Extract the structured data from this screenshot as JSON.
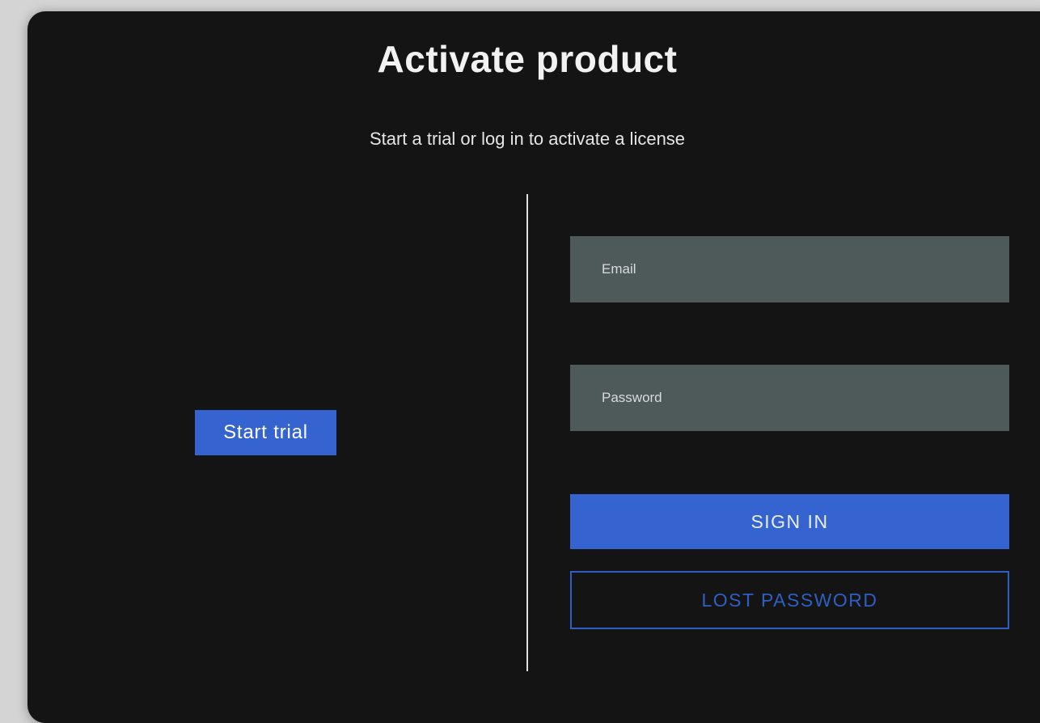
{
  "dialog": {
    "title": "Activate product",
    "subtitle": "Start a trial or log in to activate a license"
  },
  "trial": {
    "start_label": "Start trial"
  },
  "login": {
    "email_placeholder": "Email",
    "email_value": "",
    "password_placeholder": "Password",
    "password_value": "",
    "sign_in_label": "SIGN IN",
    "lost_password_label": "LOST PASSWORD"
  },
  "colors": {
    "background": "#141414",
    "accent": "#3563cf",
    "field_background": "#4d5a59",
    "text": "#f2f2f2"
  }
}
